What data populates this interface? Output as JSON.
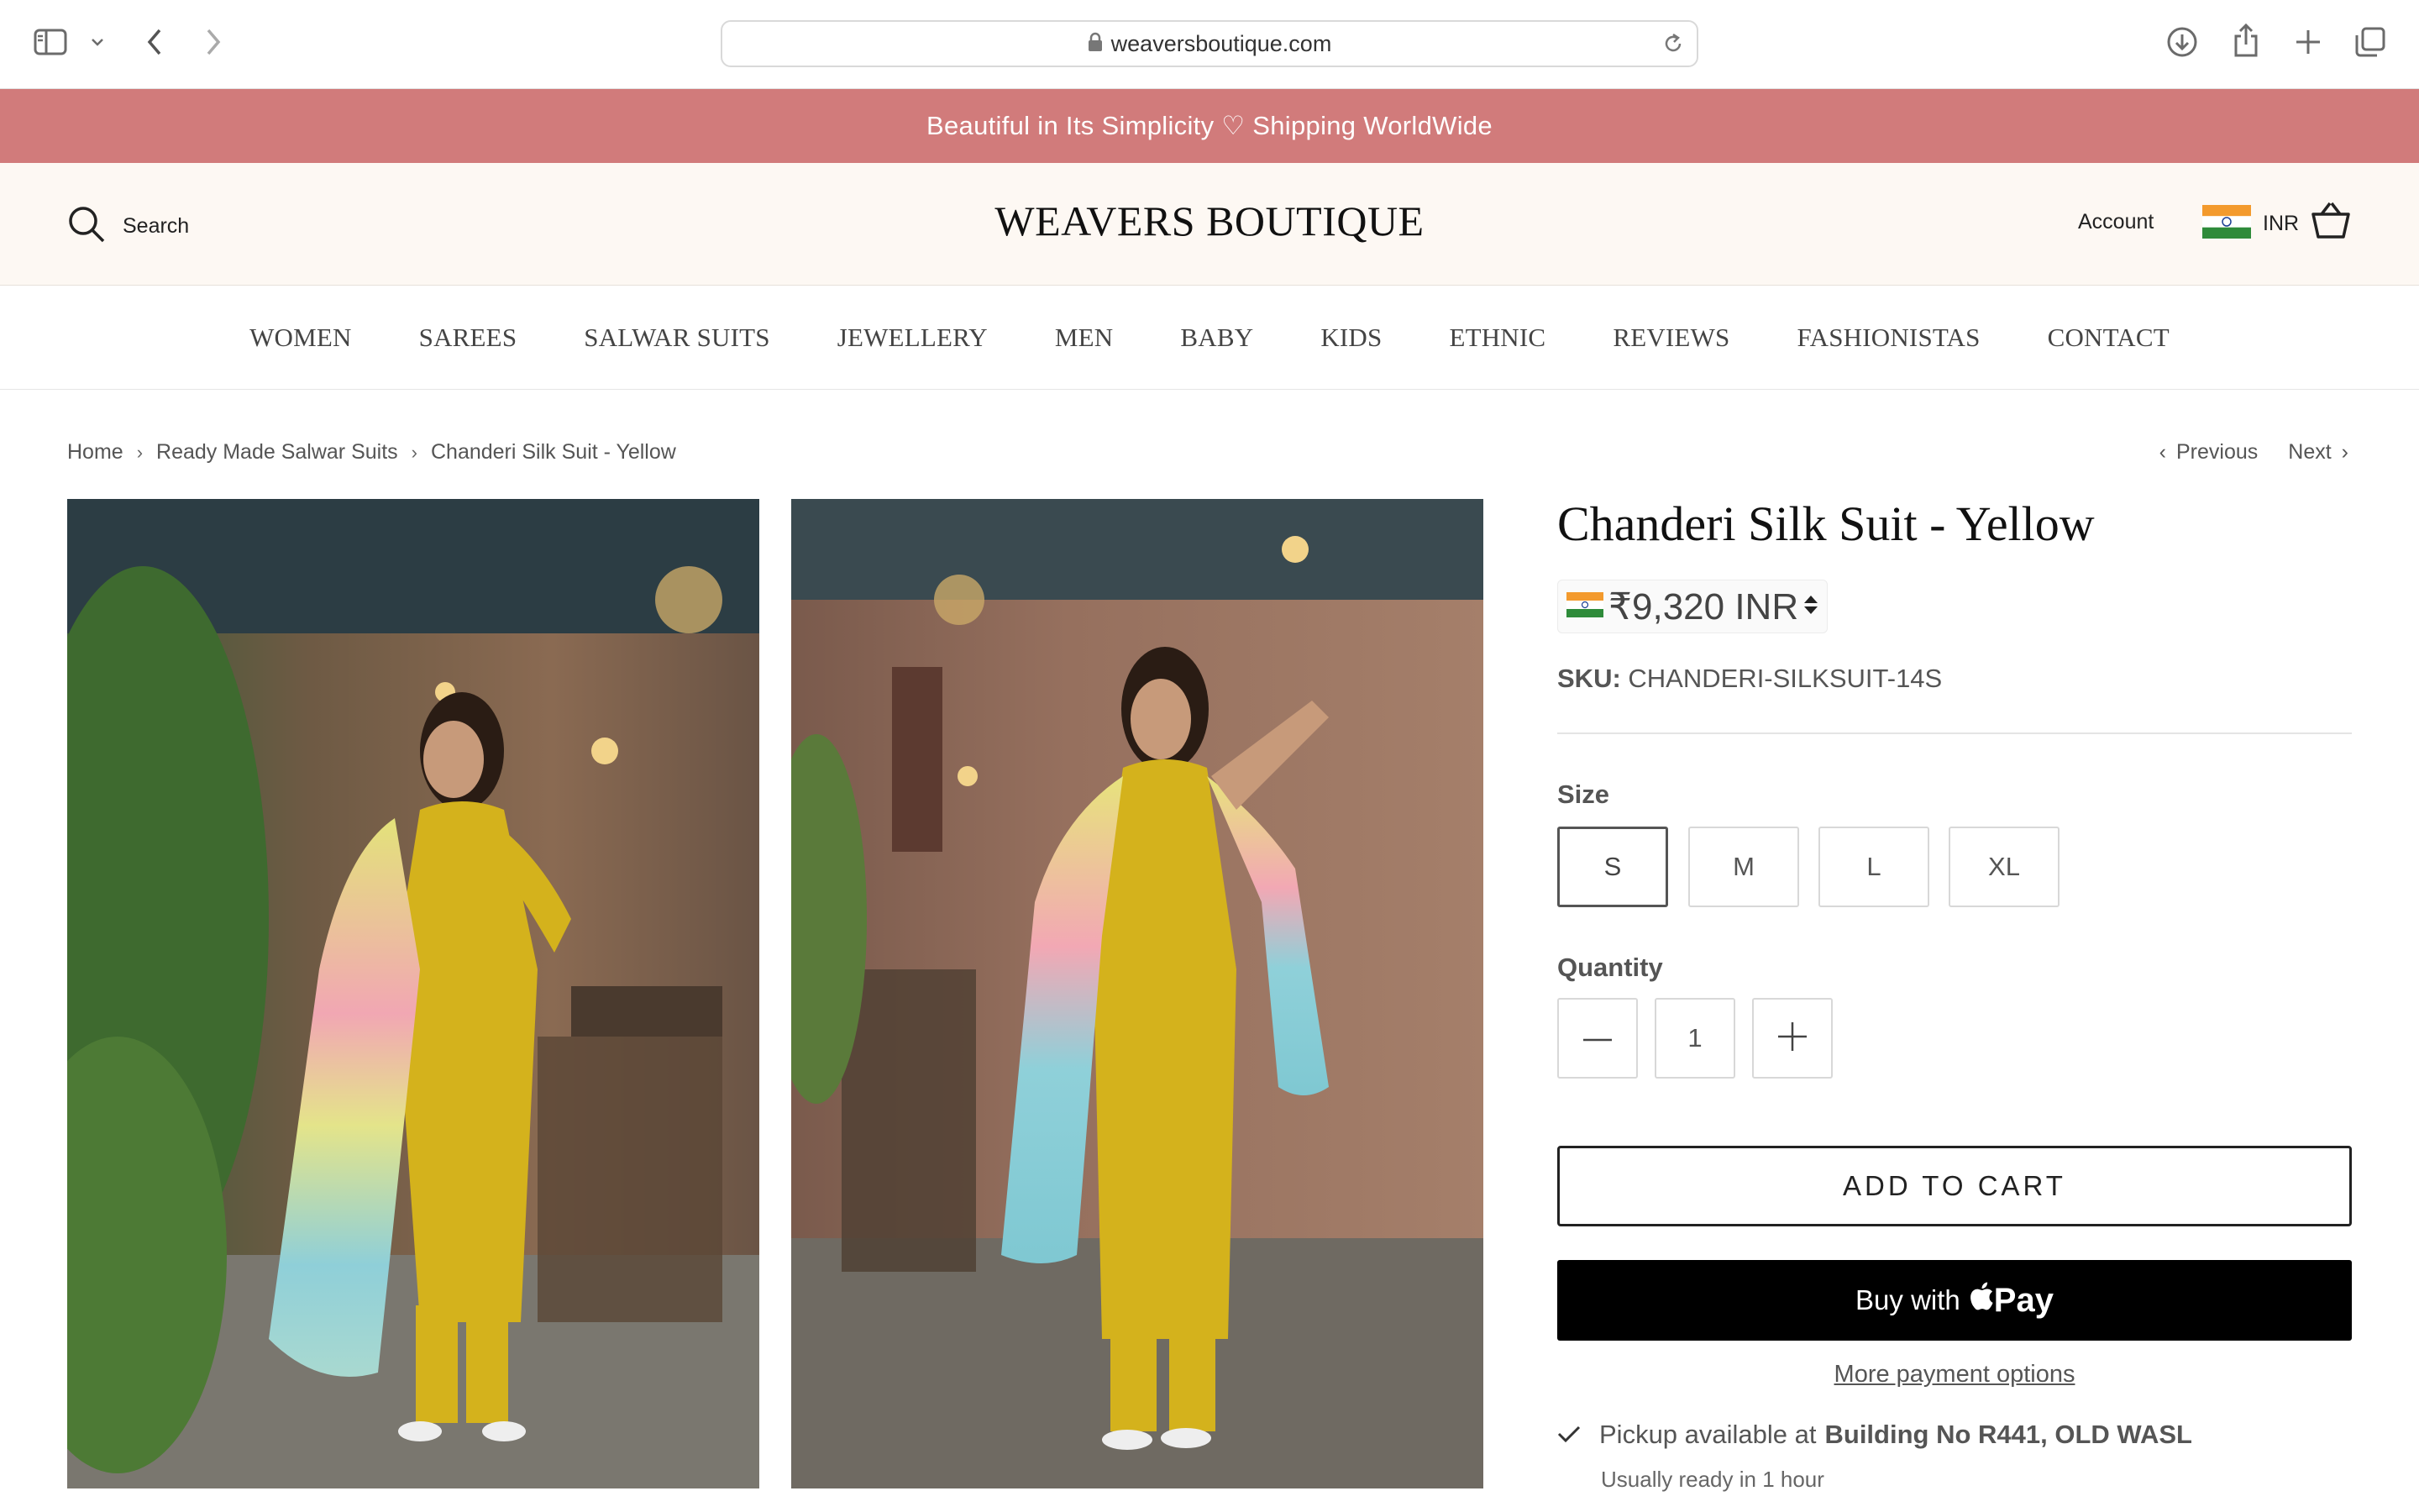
{
  "browser": {
    "url": "weaversboutique.com",
    "icons": [
      "sidebar-icon",
      "chevron-down-icon",
      "back-icon",
      "forward-icon",
      "lock-icon",
      "reload-icon",
      "download-icon",
      "share-icon",
      "plus-icon",
      "tabs-icon"
    ]
  },
  "announcement": "Beautiful in Its Simplicity ♡ Shipping WorldWide",
  "header": {
    "search_label": "Search",
    "brand": "WEAVERS BOUTIQUE",
    "account_label": "Account",
    "currency": "INR"
  },
  "nav": {
    "items": [
      "WOMEN",
      "SAREES",
      "SALWAR SUITS",
      "JEWELLERY",
      "MEN",
      "BABY",
      "KIDS",
      "ETHNIC",
      "REVIEWS",
      "FASHIONISTAS",
      "CONTACT"
    ]
  },
  "breadcrumb": {
    "items": [
      "Home",
      "Ready Made Salwar Suits",
      "Chanderi Silk Suit - Yellow"
    ],
    "previous": "Previous",
    "next": "Next"
  },
  "product": {
    "title": "Chanderi Silk Suit - Yellow",
    "price": "₹9,320 INR",
    "sku_label": "SKU:",
    "sku_value": "CHANDERI-SILKSUIT-14S",
    "size_label": "Size",
    "sizes": [
      "S",
      "M",
      "L",
      "XL"
    ],
    "selected_size": "S",
    "quantity_label": "Quantity",
    "quantity": "1",
    "add_to_cart": "ADD TO CART",
    "buy_with": "Buy with",
    "apple_pay": "Pay",
    "more_payment": "More payment options",
    "pickup_prefix": "Pickup available at",
    "pickup_location": "Building No R441, OLD WASL",
    "pickup_time": "Usually ready in 1 hour"
  },
  "colors": {
    "announcement_bg": "#d17b7b",
    "header_bg": "#fdf8f3",
    "suit_yellow": "#d4b21c"
  }
}
